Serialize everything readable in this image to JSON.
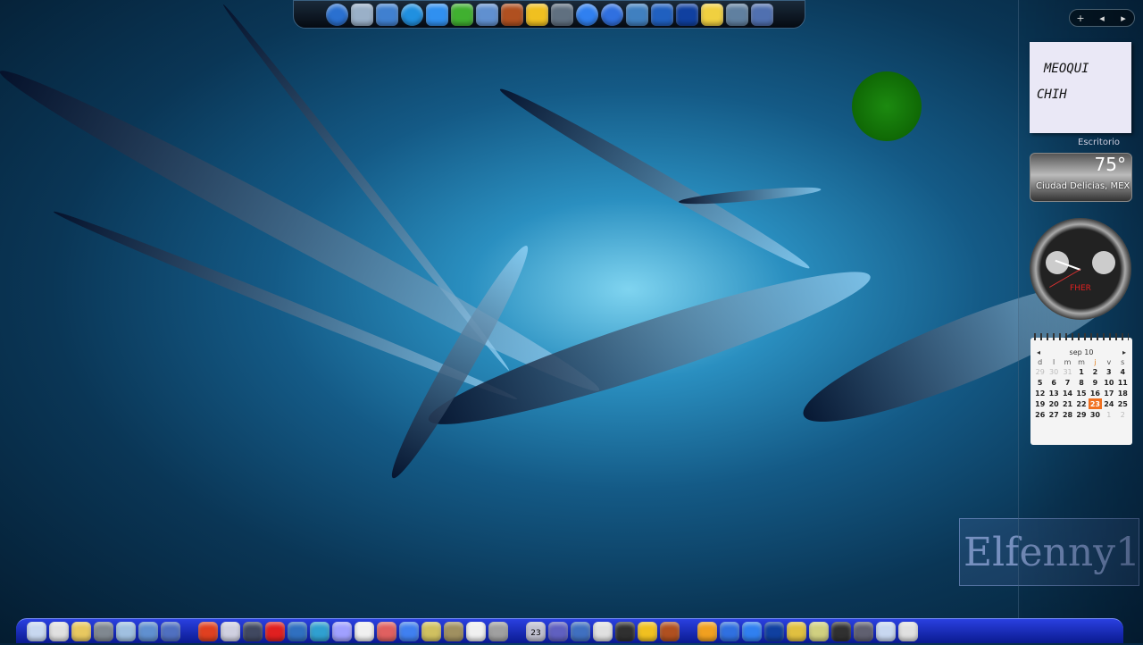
{
  "top_dock": {
    "icons": [
      "windows-start-icon",
      "notepad-icon",
      "monitor-icon",
      "search-globe-icon",
      "internet-explorer-icon",
      "messenger-icon",
      "network-icon",
      "baseball-glove-icon",
      "star-rocket-icon",
      "media-icon",
      "google-icon",
      "play-icon",
      "safari-icon",
      "orbit-icon",
      "ccleaner-icon",
      "magic-wand-icon",
      "gears-icon",
      "gears-blue-icon"
    ],
    "colors": [
      "#2a70d0",
      "#9ab0c8",
      "#4080d0",
      "#2090e0",
      "#3090f0",
      "#40b030",
      "#6090d0",
      "#b05020",
      "#f0c020",
      "#607080",
      "#3080f0",
      "#3070e0",
      "#4080c0",
      "#2060c0",
      "#1040a0",
      "#f0d040",
      "#6080a0",
      "#5070b0"
    ]
  },
  "sidebar": {
    "controls": {
      "add": "+",
      "prev": "◂",
      "next": "▸"
    },
    "note": {
      "line1": "MEOQUI",
      "line2": "CHIH"
    },
    "label": "Escritorio",
    "weather": {
      "temp": "75°",
      "city": "Ciudad Delicias, MEX"
    },
    "clock": {
      "brand": "FHER"
    },
    "calendar": {
      "month": "sep 10",
      "prev": "◂",
      "next": "▸",
      "days": [
        "d",
        "l",
        "m",
        "m",
        "j",
        "v",
        "s"
      ],
      "weeks": [
        [
          "29",
          "30",
          "31",
          "1",
          "2",
          "3",
          "4"
        ],
        [
          "5",
          "6",
          "7",
          "8",
          "9",
          "10",
          "11"
        ],
        [
          "12",
          "13",
          "14",
          "15",
          "16",
          "17",
          "18"
        ],
        [
          "19",
          "20",
          "21",
          "22",
          "23",
          "24",
          "25"
        ],
        [
          "26",
          "27",
          "28",
          "29",
          "30",
          "1",
          "2"
        ]
      ],
      "today": "23"
    }
  },
  "watermark": "Elfenny1",
  "bottom_dock": {
    "groups": [
      [
        "computer-icon",
        "drive-icon",
        "folder-icon",
        "film-folder-icon",
        "pictures-folder-icon",
        "music-folder-icon",
        "network-folder-icon"
      ],
      [
        "windows-start-icon",
        "power-icon",
        "desktop-icon",
        "media-player-icon",
        "youtube-icon",
        "thunderbird-icon",
        "utorrent-icon",
        "itunes-icon",
        "network-icon",
        "paint-icon",
        "paint-ball-icon",
        "dragon-icon",
        "notes-icon",
        "pen-icon"
      ],
      [
        "calendar-icon",
        "calculator-icon",
        "notepad-icon",
        "recycle-icon",
        "gears-icon",
        "mouse-icon",
        "help-icon"
      ],
      [
        "star-icon",
        "baseball-glove-icon",
        "rocket-icon",
        "skype-icon",
        "google-icon",
        "ccleaner-icon",
        "folder-icon",
        "note-icon",
        "webcam-icon",
        "trash-icon"
      ]
    ],
    "calendar_badge": "23"
  }
}
